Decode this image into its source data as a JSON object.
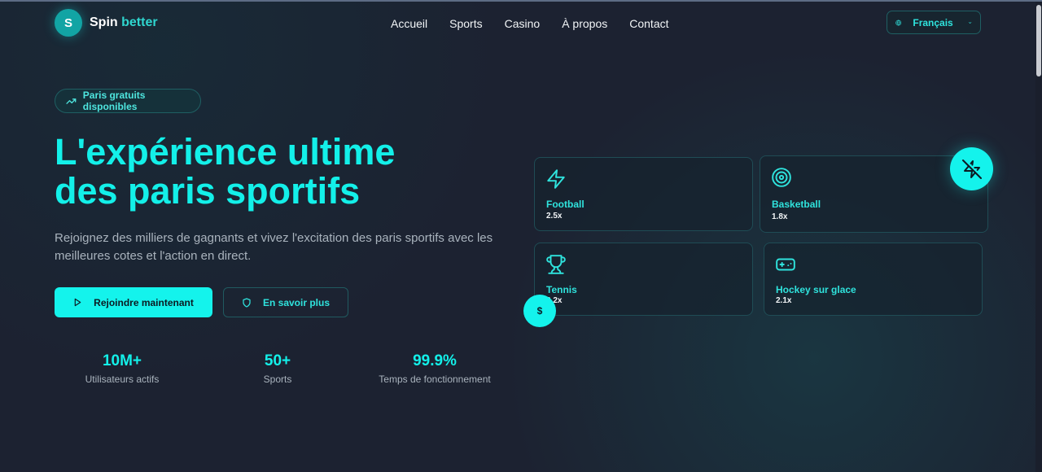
{
  "brand": {
    "initial": "S",
    "name_part1": "Spin",
    "name_part2": "better"
  },
  "nav": {
    "items": [
      "Accueil",
      "Sports",
      "Casino",
      "À propos",
      "Contact"
    ]
  },
  "language": {
    "selected": "Français",
    "icon": "globe-icon"
  },
  "hero": {
    "badge": "Paris gratuits disponibles",
    "title_line1": "L'expérience ultime",
    "title_line2": "des paris sportifs",
    "description": "Rejoignez des milliers de gagnants et vivez l'excitation des paris sportifs avec les meilleures cotes et l'action en direct.",
    "primary_cta": "Rejoindre maintenant",
    "secondary_cta": "En savoir plus"
  },
  "stats": [
    {
      "value": "10M+",
      "label": "Utilisateurs actifs"
    },
    {
      "value": "50+",
      "label": "Sports"
    },
    {
      "value": "99.9%",
      "label": "Temps de fonctionnement"
    }
  ],
  "sports": [
    {
      "name": "Football",
      "odds": "2.5x",
      "icon": "bolt-icon"
    },
    {
      "name": "Basketball",
      "odds": "1.8x",
      "icon": "target-icon"
    },
    {
      "name": "Tennis",
      "odds": "3.2x",
      "icon": "trophy-icon"
    },
    {
      "name": "Hockey sur glace",
      "odds": "2.1x",
      "icon": "gamepad-icon"
    }
  ],
  "floating": {
    "dollar": "$"
  },
  "colors": {
    "accent": "#14f3ec",
    "background": "#1c2231",
    "muted_text": "#a9b3bd"
  }
}
